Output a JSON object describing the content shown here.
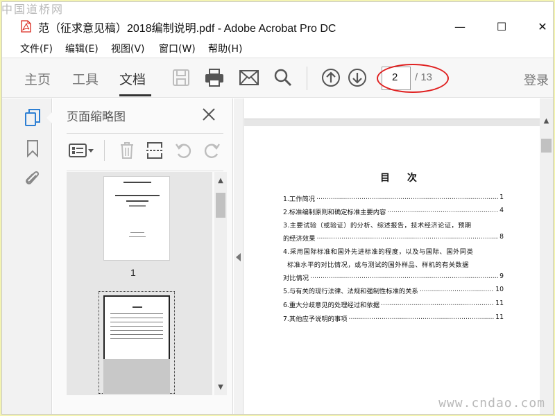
{
  "watermarks": {
    "top": "中国道桥网",
    "bottom": "www.cndao.com"
  },
  "window": {
    "title": "范（征求意见稿）2018编制说明.pdf - Adobe Acrobat Pro DC",
    "controls": {
      "minimize": "—",
      "maximize": "☐",
      "close": "✕"
    }
  },
  "menu": [
    "文件(F)",
    "编辑(E)",
    "视图(V)",
    "窗口(W)",
    "帮助(H)"
  ],
  "toolbar": {
    "tabs": [
      "主页",
      "工具",
      "文档"
    ],
    "active_tab": "文档",
    "icons": [
      "save-icon",
      "print-icon",
      "email-icon",
      "search-icon",
      "page-up-icon",
      "page-down-icon"
    ],
    "page_current": "2",
    "page_total": "/ 13",
    "login": "登录"
  },
  "left_rail": {
    "icons": [
      "page-thumbnails-icon",
      "bookmark-icon",
      "attachment-icon"
    ]
  },
  "thumbnail_panel": {
    "title": "页面缩略图",
    "tools": [
      "options-icon",
      "delete-icon",
      "insert-icon",
      "rotate-left-icon",
      "rotate-right-icon"
    ],
    "pages": [
      {
        "label": "1"
      }
    ]
  },
  "document": {
    "toc_title": "目 次",
    "entries": [
      {
        "text": "1.工作简况",
        "page": "1"
      },
      {
        "text": "2.标准编制原则和确定标准主要内容",
        "page": "4"
      },
      {
        "text": "3.主要试验（或验证）的分析、综述报告，技术经济论证，预期",
        "page": ""
      },
      {
        "text": "的经济效果",
        "page": "8"
      },
      {
        "text": "4.采用国际标准和国外先进标准的程度，以及与国际、国外同类",
        "page": ""
      },
      {
        "text": "标准水平的对比情况，或与测试的国外样品、样机的有关数据",
        "page": ""
      },
      {
        "text": "对比情况",
        "page": "9"
      },
      {
        "text": "5.与有关的现行法律、法规和强制性标准的关系",
        "page": "10"
      },
      {
        "text": "6.重大分歧意见的处理经过和依据",
        "page": "11"
      },
      {
        "text": "7.其他应予说明的事项",
        "page": "11"
      }
    ]
  },
  "colors": {
    "annotation": "#e02020",
    "toolbar_bg": "#f7f7f7",
    "panel_bg": "#fafafa",
    "app_red": "#d9261c"
  }
}
